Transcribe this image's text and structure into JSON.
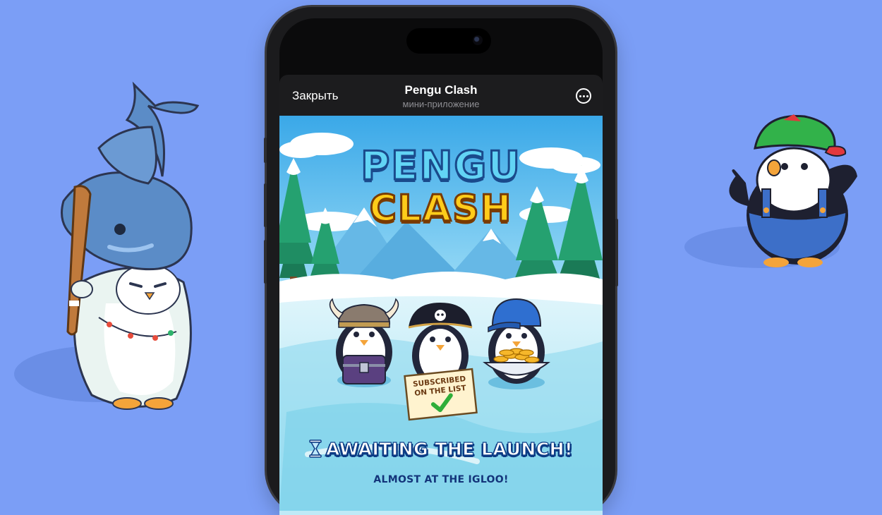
{
  "miniapp_header": {
    "close_label": "Закрыть",
    "title": "Pengu Clash",
    "subtitle": "мини-приложение",
    "menu_icon": "more-options-icon"
  },
  "game": {
    "logo_line1": "PENGU",
    "logo_line2": "CLASH",
    "sign_line1": "SUBSCRIBED",
    "sign_line2": "ON THE LIST",
    "status_title": "AWAITING THE LAUNCH!",
    "status_subtitle": "ALMOST AT THE IGLOO!",
    "status_icon": "hourglass-icon"
  },
  "colors": {
    "background": "#7b9ef6",
    "header_bg": "#1c1c1e",
    "logo_top": "#62d4f5",
    "logo_bottom": "#ffcc1a",
    "status_title_outline": "#0d3c85"
  }
}
